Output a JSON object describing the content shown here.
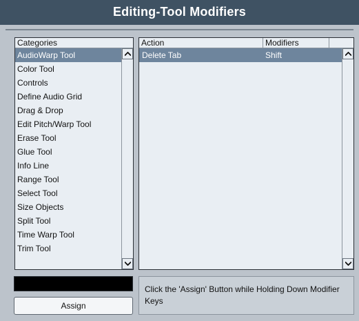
{
  "window": {
    "title": "Editing-Tool Modifiers"
  },
  "categories": {
    "header": "Categories",
    "selected_index": 0,
    "items": [
      "AudioWarp Tool",
      "Color Tool",
      "Controls",
      "Define Audio Grid",
      "Drag & Drop",
      "Edit Pitch/Warp Tool",
      "Erase Tool",
      "Glue Tool",
      "Info Line",
      "Range Tool",
      "Select Tool",
      "Size Objects",
      "Split Tool",
      "Time Warp Tool",
      "Trim Tool"
    ]
  },
  "actions": {
    "header_action": "Action",
    "header_modifiers": "Modifiers",
    "rows": [
      {
        "action": "Delete Tab",
        "modifiers": "Shift"
      }
    ]
  },
  "assign": {
    "label": "Assign"
  },
  "hint": {
    "text": "Click the 'Assign' Button while Holding Down Modifier Keys"
  },
  "colors": {
    "selection": "#6e859d",
    "titlebar": "#3f5263",
    "window": "#bcc3cb"
  }
}
